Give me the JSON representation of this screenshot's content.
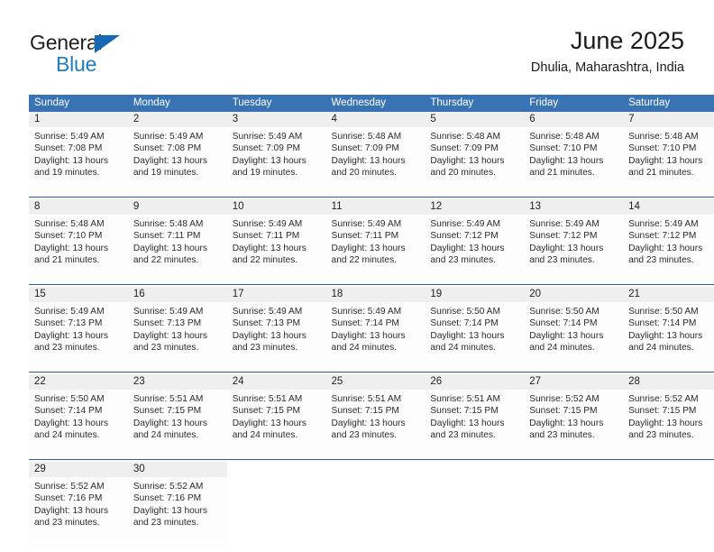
{
  "brand": {
    "name_part1": "General",
    "name_part2": "Blue",
    "triangle_icon": "triangle-icon",
    "accent_color": "#1668b3",
    "text_color": "#231f20"
  },
  "header": {
    "title": "June 2025",
    "location": "Dhulia, Maharashtra, India"
  },
  "theme": {
    "header_bg": "#3973b3",
    "header_text": "#ffffff",
    "daynum_bg": "#efefef",
    "week_separator": "#2a6099",
    "cell_bg": "#fdfdfd"
  },
  "calendar": {
    "weekday_headers": [
      "Sunday",
      "Monday",
      "Tuesday",
      "Wednesday",
      "Thursday",
      "Friday",
      "Saturday"
    ],
    "weeks": [
      [
        {
          "day": "1",
          "sunrise": "Sunrise: 5:49 AM",
          "sunset": "Sunset: 7:08 PM",
          "daylight_line1": "Daylight: 13 hours",
          "daylight_line2": "and 19 minutes."
        },
        {
          "day": "2",
          "sunrise": "Sunrise: 5:49 AM",
          "sunset": "Sunset: 7:08 PM",
          "daylight_line1": "Daylight: 13 hours",
          "daylight_line2": "and 19 minutes."
        },
        {
          "day": "3",
          "sunrise": "Sunrise: 5:49 AM",
          "sunset": "Sunset: 7:09 PM",
          "daylight_line1": "Daylight: 13 hours",
          "daylight_line2": "and 19 minutes."
        },
        {
          "day": "4",
          "sunrise": "Sunrise: 5:48 AM",
          "sunset": "Sunset: 7:09 PM",
          "daylight_line1": "Daylight: 13 hours",
          "daylight_line2": "and 20 minutes."
        },
        {
          "day": "5",
          "sunrise": "Sunrise: 5:48 AM",
          "sunset": "Sunset: 7:09 PM",
          "daylight_line1": "Daylight: 13 hours",
          "daylight_line2": "and 20 minutes."
        },
        {
          "day": "6",
          "sunrise": "Sunrise: 5:48 AM",
          "sunset": "Sunset: 7:10 PM",
          "daylight_line1": "Daylight: 13 hours",
          "daylight_line2": "and 21 minutes."
        },
        {
          "day": "7",
          "sunrise": "Sunrise: 5:48 AM",
          "sunset": "Sunset: 7:10 PM",
          "daylight_line1": "Daylight: 13 hours",
          "daylight_line2": "and 21 minutes."
        }
      ],
      [
        {
          "day": "8",
          "sunrise": "Sunrise: 5:48 AM",
          "sunset": "Sunset: 7:10 PM",
          "daylight_line1": "Daylight: 13 hours",
          "daylight_line2": "and 21 minutes."
        },
        {
          "day": "9",
          "sunrise": "Sunrise: 5:48 AM",
          "sunset": "Sunset: 7:11 PM",
          "daylight_line1": "Daylight: 13 hours",
          "daylight_line2": "and 22 minutes."
        },
        {
          "day": "10",
          "sunrise": "Sunrise: 5:49 AM",
          "sunset": "Sunset: 7:11 PM",
          "daylight_line1": "Daylight: 13 hours",
          "daylight_line2": "and 22 minutes."
        },
        {
          "day": "11",
          "sunrise": "Sunrise: 5:49 AM",
          "sunset": "Sunset: 7:11 PM",
          "daylight_line1": "Daylight: 13 hours",
          "daylight_line2": "and 22 minutes."
        },
        {
          "day": "12",
          "sunrise": "Sunrise: 5:49 AM",
          "sunset": "Sunset: 7:12 PM",
          "daylight_line1": "Daylight: 13 hours",
          "daylight_line2": "and 23 minutes."
        },
        {
          "day": "13",
          "sunrise": "Sunrise: 5:49 AM",
          "sunset": "Sunset: 7:12 PM",
          "daylight_line1": "Daylight: 13 hours",
          "daylight_line2": "and 23 minutes."
        },
        {
          "day": "14",
          "sunrise": "Sunrise: 5:49 AM",
          "sunset": "Sunset: 7:12 PM",
          "daylight_line1": "Daylight: 13 hours",
          "daylight_line2": "and 23 minutes."
        }
      ],
      [
        {
          "day": "15",
          "sunrise": "Sunrise: 5:49 AM",
          "sunset": "Sunset: 7:13 PM",
          "daylight_line1": "Daylight: 13 hours",
          "daylight_line2": "and 23 minutes."
        },
        {
          "day": "16",
          "sunrise": "Sunrise: 5:49 AM",
          "sunset": "Sunset: 7:13 PM",
          "daylight_line1": "Daylight: 13 hours",
          "daylight_line2": "and 23 minutes."
        },
        {
          "day": "17",
          "sunrise": "Sunrise: 5:49 AM",
          "sunset": "Sunset: 7:13 PM",
          "daylight_line1": "Daylight: 13 hours",
          "daylight_line2": "and 23 minutes."
        },
        {
          "day": "18",
          "sunrise": "Sunrise: 5:49 AM",
          "sunset": "Sunset: 7:14 PM",
          "daylight_line1": "Daylight: 13 hours",
          "daylight_line2": "and 24 minutes."
        },
        {
          "day": "19",
          "sunrise": "Sunrise: 5:50 AM",
          "sunset": "Sunset: 7:14 PM",
          "daylight_line1": "Daylight: 13 hours",
          "daylight_line2": "and 24 minutes."
        },
        {
          "day": "20",
          "sunrise": "Sunrise: 5:50 AM",
          "sunset": "Sunset: 7:14 PM",
          "daylight_line1": "Daylight: 13 hours",
          "daylight_line2": "and 24 minutes."
        },
        {
          "day": "21",
          "sunrise": "Sunrise: 5:50 AM",
          "sunset": "Sunset: 7:14 PM",
          "daylight_line1": "Daylight: 13 hours",
          "daylight_line2": "and 24 minutes."
        }
      ],
      [
        {
          "day": "22",
          "sunrise": "Sunrise: 5:50 AM",
          "sunset": "Sunset: 7:14 PM",
          "daylight_line1": "Daylight: 13 hours",
          "daylight_line2": "and 24 minutes."
        },
        {
          "day": "23",
          "sunrise": "Sunrise: 5:51 AM",
          "sunset": "Sunset: 7:15 PM",
          "daylight_line1": "Daylight: 13 hours",
          "daylight_line2": "and 24 minutes."
        },
        {
          "day": "24",
          "sunrise": "Sunrise: 5:51 AM",
          "sunset": "Sunset: 7:15 PM",
          "daylight_line1": "Daylight: 13 hours",
          "daylight_line2": "and 24 minutes."
        },
        {
          "day": "25",
          "sunrise": "Sunrise: 5:51 AM",
          "sunset": "Sunset: 7:15 PM",
          "daylight_line1": "Daylight: 13 hours",
          "daylight_line2": "and 23 minutes."
        },
        {
          "day": "26",
          "sunrise": "Sunrise: 5:51 AM",
          "sunset": "Sunset: 7:15 PM",
          "daylight_line1": "Daylight: 13 hours",
          "daylight_line2": "and 23 minutes."
        },
        {
          "day": "27",
          "sunrise": "Sunrise: 5:52 AM",
          "sunset": "Sunset: 7:15 PM",
          "daylight_line1": "Daylight: 13 hours",
          "daylight_line2": "and 23 minutes."
        },
        {
          "day": "28",
          "sunrise": "Sunrise: 5:52 AM",
          "sunset": "Sunset: 7:15 PM",
          "daylight_line1": "Daylight: 13 hours",
          "daylight_line2": "and 23 minutes."
        }
      ],
      [
        {
          "day": "29",
          "sunrise": "Sunrise: 5:52 AM",
          "sunset": "Sunset: 7:16 PM",
          "daylight_line1": "Daylight: 13 hours",
          "daylight_line2": "and 23 minutes."
        },
        {
          "day": "30",
          "sunrise": "Sunrise: 5:52 AM",
          "sunset": "Sunset: 7:16 PM",
          "daylight_line1": "Daylight: 13 hours",
          "daylight_line2": "and 23 minutes."
        },
        {
          "day": "",
          "sunrise": "",
          "sunset": "",
          "daylight_line1": "",
          "daylight_line2": ""
        },
        {
          "day": "",
          "sunrise": "",
          "sunset": "",
          "daylight_line1": "",
          "daylight_line2": ""
        },
        {
          "day": "",
          "sunrise": "",
          "sunset": "",
          "daylight_line1": "",
          "daylight_line2": ""
        },
        {
          "day": "",
          "sunrise": "",
          "sunset": "",
          "daylight_line1": "",
          "daylight_line2": ""
        },
        {
          "day": "",
          "sunrise": "",
          "sunset": "",
          "daylight_line1": "",
          "daylight_line2": ""
        }
      ]
    ]
  }
}
